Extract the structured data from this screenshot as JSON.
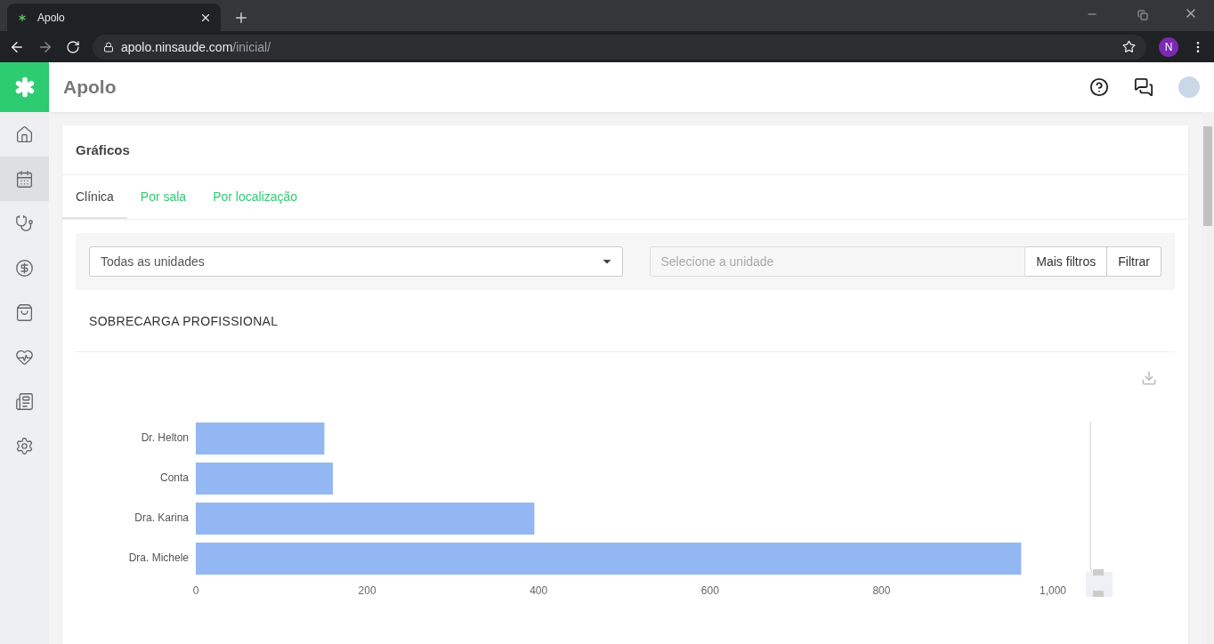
{
  "browser": {
    "tab_title": "Apolo",
    "url_host": "apolo.ninsaude.com",
    "url_path": "/inicial/",
    "profile_initial": "N"
  },
  "app": {
    "title": "Apolo"
  },
  "sidebar": {
    "items": [
      {
        "kind": "home",
        "selected": false
      },
      {
        "kind": "calendar",
        "selected": true
      },
      {
        "kind": "stethoscope",
        "selected": false
      },
      {
        "kind": "money",
        "selected": false
      },
      {
        "kind": "bag",
        "selected": false
      },
      {
        "kind": "health",
        "selected": false
      },
      {
        "kind": "list",
        "selected": false
      },
      {
        "kind": "settings",
        "selected": false
      }
    ]
  },
  "card": {
    "title": "Gráficos"
  },
  "tabs": [
    {
      "label": "Clínica",
      "selected": true
    },
    {
      "label": "Por sala",
      "selected": false
    },
    {
      "label": "Por localização",
      "selected": false
    }
  ],
  "filters": {
    "unit_select": "Todas as unidades",
    "unit_search": {
      "placeholder": "Selecione a unidade"
    },
    "buttons": [
      "Mais filtros",
      "Filtrar"
    ]
  },
  "section": {
    "title": "SOBRECARGA PROFISSIONAL",
    "chart_data": {
      "type": "bar",
      "orientation": "horizontal",
      "categories": [
        "Dr. Helton",
        "Conta",
        "Dra. Karina",
        "Dra. Michele"
      ],
      "series": [
        {
          "color": "#93b7f3",
          "values": [
            150,
            160,
            395,
            963
          ]
        }
      ],
      "xlim": [
        0,
        1000
      ],
      "xticks": [
        0,
        200,
        400,
        600,
        800,
        {
          "value": 1000,
          "label": "1,000"
        }
      ]
    }
  }
}
